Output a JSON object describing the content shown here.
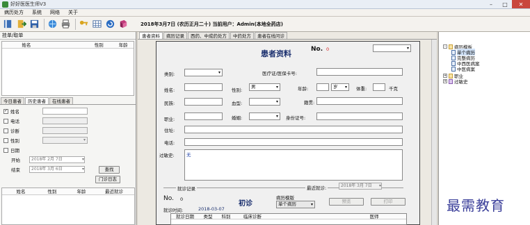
{
  "window": {
    "title": "好好医医生师V3"
  },
  "menu": [
    "病历处方",
    "系统",
    "网络",
    "关于"
  ],
  "toolbar": {
    "icons": [
      "book-icon",
      "exit-icon",
      "save-icon",
      "globe-icon",
      "printer-icon",
      "key-icon",
      "grid-icon",
      "refresh-icon",
      "help-book-icon"
    ],
    "status": "2018年3月7日 (农历正月二十)   当前用户：Admin(本地全药店)"
  },
  "left": {
    "top_title": "挂单/取单",
    "top_columns": [
      "姓名",
      "性别",
      "年龄"
    ],
    "tabs": [
      "今日患者",
      "历史患者",
      "在线患者"
    ],
    "active_tab": 1,
    "filters": [
      {
        "label": "姓名",
        "checked": true,
        "kind": "text"
      },
      {
        "label": "电话",
        "checked": false,
        "kind": "text"
      },
      {
        "label": "诊断",
        "checked": false,
        "kind": "text"
      },
      {
        "label": "性别",
        "checked": false,
        "kind": "select"
      },
      {
        "label": "日期",
        "checked": false,
        "kind": "none"
      }
    ],
    "start_label": "开始",
    "start_date": "2018年 2月 7日",
    "end_label": "结束",
    "end_date": "2018年 3月 6日",
    "search_button": "查找",
    "log_button": "门诊日志",
    "bottom_columns": [
      "姓名",
      "性别",
      "年龄",
      "最近就诊"
    ]
  },
  "center": {
    "tabs": [
      "患者资料",
      "病历记录",
      "西药、中成药处方",
      "中药处方",
      "患者在线问诊"
    ],
    "active_tab": 0,
    "form": {
      "title": "患者资料",
      "no_label": "No.",
      "no_value": "0",
      "category_label": "类别:",
      "medicard_label": "医疗证/医保卡号:",
      "name_label": "姓名:",
      "gender_label": "性别:",
      "gender_value": "男",
      "age_label": "年龄:",
      "age_unit": "岁",
      "weight_label": "体重:",
      "weight_unit": "千克",
      "ethnic_label": "民族:",
      "blood_label": "血型:",
      "native_label": "籍贯:",
      "job_label": "职业:",
      "marriage_label": "婚姻:",
      "idcard_label": "身份证号:",
      "address_label": "住址:",
      "phone_label": "电话:",
      "allergy_label": "过敏史:",
      "allergy_value": "无"
    },
    "visit": {
      "record_label": "就诊记录",
      "recent_label": "最近就诊:",
      "recent_date": "2018年 3月 7日",
      "no_label": "No.",
      "no_value": "0",
      "first_visit": "初诊",
      "template_label": "病历模版",
      "template_value": "单个病历",
      "time_label": "就诊时间:",
      "time_value": "2018-03-07",
      "preview_button": "预览",
      "print_button": "打印",
      "columns": [
        "就诊日期",
        "类型",
        "科别",
        "临床诊断",
        "医师"
      ]
    }
  },
  "right": {
    "tree": [
      {
        "label": "病历模板",
        "level": 0,
        "expander": "-"
      },
      {
        "label": "单个病历",
        "level": 1,
        "selected": true
      },
      {
        "label": "完整病历",
        "level": 1
      },
      {
        "label": "中西医病案",
        "level": 1
      },
      {
        "label": "中医病案",
        "level": 1
      },
      {
        "label": "职业",
        "level": 0,
        "expander": "+"
      },
      {
        "label": "过敏史",
        "level": 0,
        "expander": "+"
      }
    ]
  },
  "watermark": "最需教育",
  "colors": {
    "red_text": "#d41c1c",
    "title_blue": "#1a2f6e",
    "close_btn": "#c9463d"
  }
}
